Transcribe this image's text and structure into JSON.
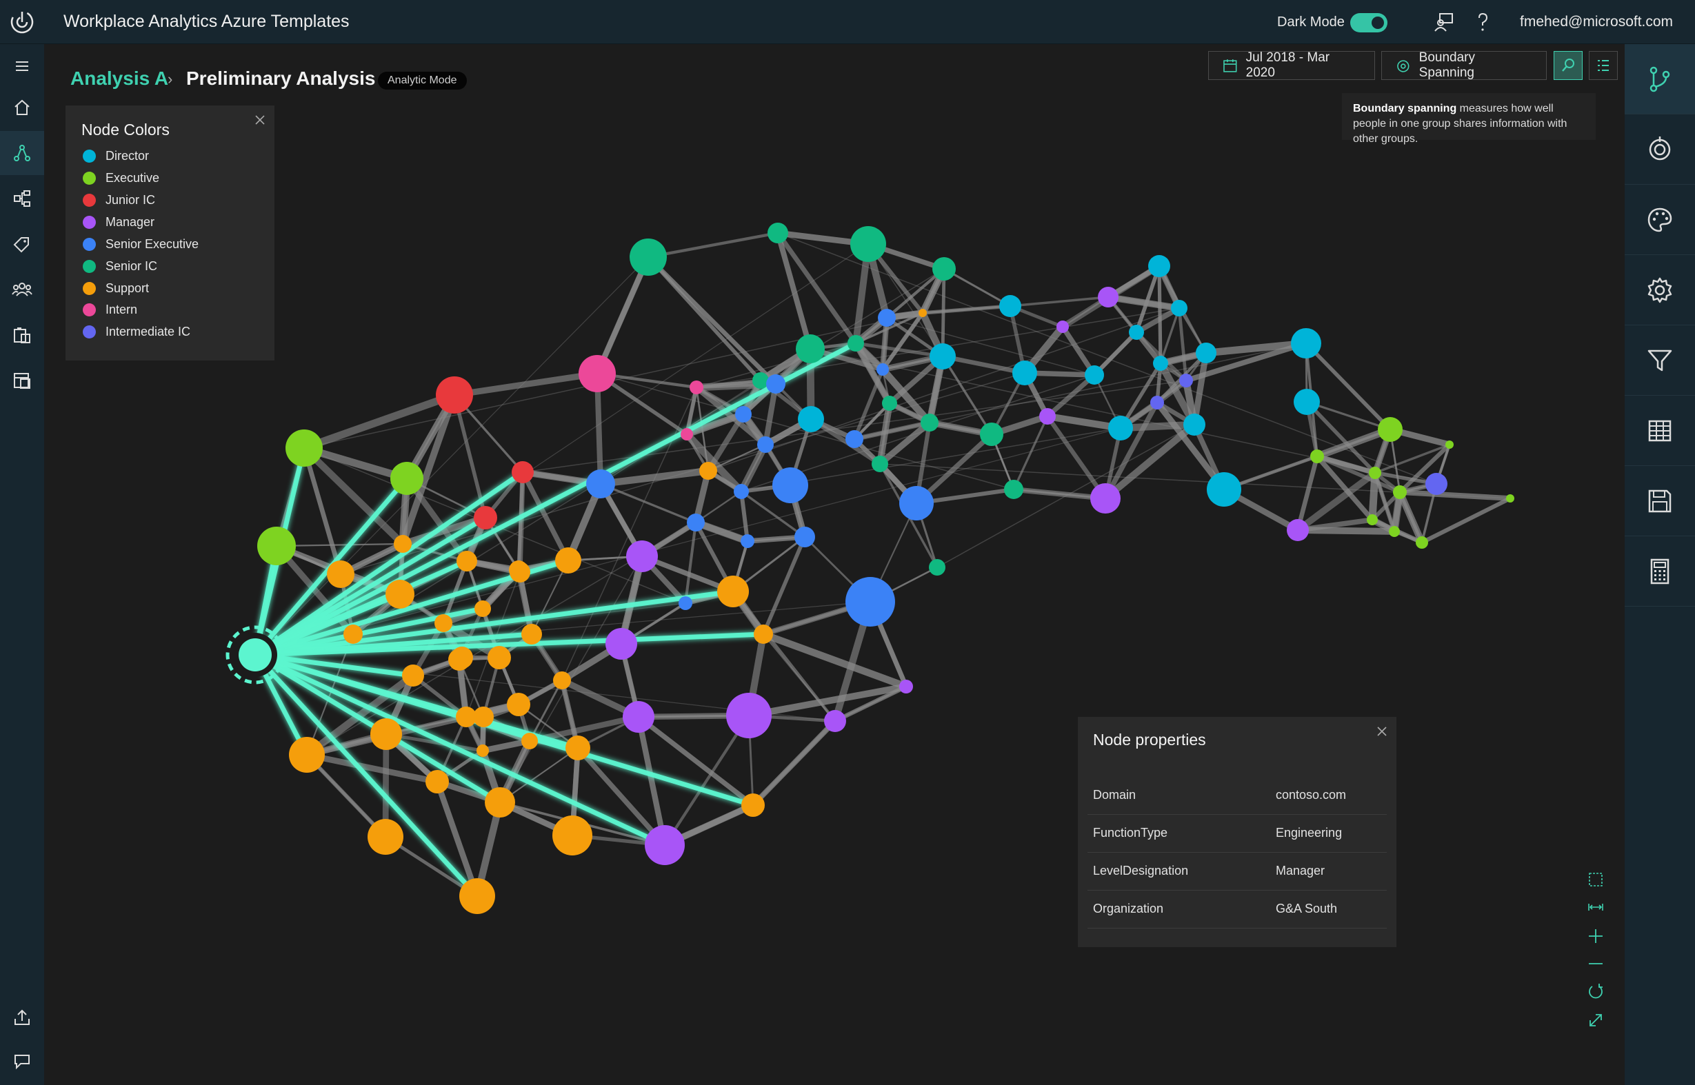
{
  "app": {
    "title": "Workplace Analytics Azure Templates",
    "dark_mode_label": "Dark Mode",
    "dark_mode_on": true,
    "user_email": "fmehed@microsoft.com"
  },
  "breadcrumb": {
    "parent": "Analysis A",
    "separator": "›",
    "current": "Preliminary Analysis",
    "mode_badge": "Analytic Mode"
  },
  "toolbar": {
    "date_range": "Jul 2018 - Mar 2020",
    "metric": "Boundary Spanning"
  },
  "tooltip": {
    "term": "Boundary spanning",
    "text": " measures how well people in one group shares information with other groups."
  },
  "legend": {
    "title": "Node Colors",
    "items": [
      {
        "label": "Director",
        "color": "#00b4d8"
      },
      {
        "label": "Executive",
        "color": "#7ed321"
      },
      {
        "label": "Junior IC",
        "color": "#e8393c"
      },
      {
        "label": "Manager",
        "color": "#a855f7"
      },
      {
        "label": "Senior Executive",
        "color": "#3b82f6"
      },
      {
        "label": "Senior IC",
        "color": "#10b981"
      },
      {
        "label": "Support",
        "color": "#f59e0b"
      },
      {
        "label": "Intern",
        "color": "#ec4899"
      },
      {
        "label": "Intermediate IC",
        "color": "#6366f1"
      }
    ]
  },
  "node_properties": {
    "title": "Node properties",
    "rows": [
      {
        "key": "Domain",
        "value": "contoso.com"
      },
      {
        "key": "FunctionType",
        "value": "Engineering"
      },
      {
        "key": "LevelDesignation",
        "value": "Manager"
      },
      {
        "key": "Organization",
        "value": "G&A South"
      }
    ]
  },
  "colors": {
    "accent": "#3fd1b0",
    "highlight_edge": "#5cf5cf",
    "edge": "#7a7a7a",
    "background": "#1c1c1c",
    "rail": "#17262f"
  },
  "icons": {
    "left_rail": [
      "hamburger-icon",
      "home-icon",
      "network-icon",
      "hierarchy-icon",
      "tag-icon",
      "people-icon",
      "reports-icon",
      "dashboard-icon",
      "share-icon",
      "feedback-icon"
    ],
    "right_rail": [
      "graph-branch-icon",
      "target-icon",
      "palette-icon",
      "gear-icon",
      "filter-icon",
      "table-icon",
      "save-icon",
      "calculator-icon"
    ],
    "zoom_controls": [
      "select-area-icon",
      "fit-width-icon",
      "zoom-in-icon",
      "zoom-out-icon",
      "reset-icon",
      "expand-icon"
    ]
  }
}
